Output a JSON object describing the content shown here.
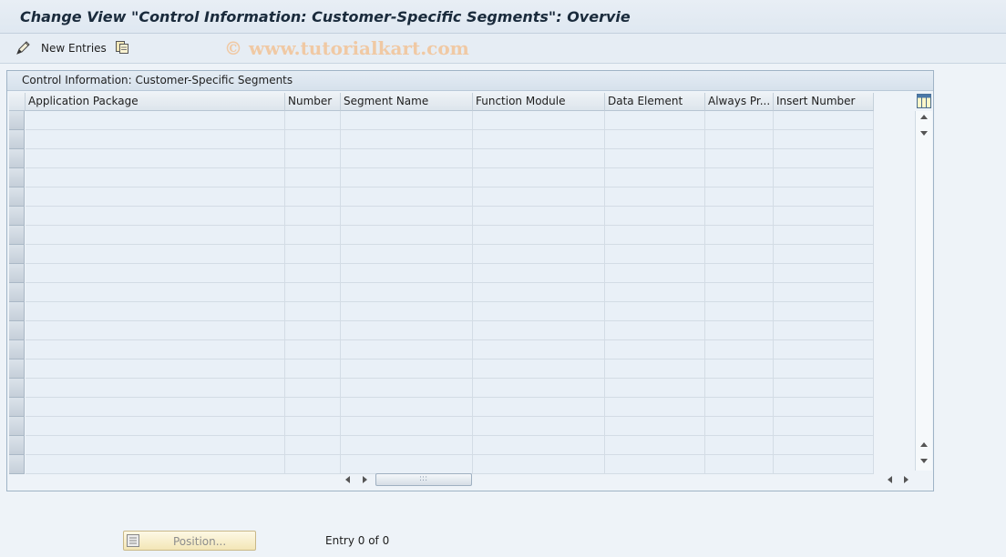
{
  "window": {
    "title": "Change View \"Control Information: Customer-Specific Segments\": Overvie"
  },
  "toolbar": {
    "new_entries_label": "New Entries",
    "watermark": "© www.tutorialkart.com"
  },
  "table": {
    "title": "Control Information: Customer-Specific Segments",
    "columns": [
      "Application Package",
      "Number",
      "Segment Name",
      "Function Module",
      "Data Element",
      "Always Pr...",
      "Insert Number"
    ],
    "visible_rows": 19
  },
  "footer": {
    "position_label": "Position...",
    "entry_text": "Entry 0 of 0"
  },
  "colors": {
    "background": "#eef3f8",
    "cell": "#e9f0f7",
    "border": "#9fb3c6"
  }
}
